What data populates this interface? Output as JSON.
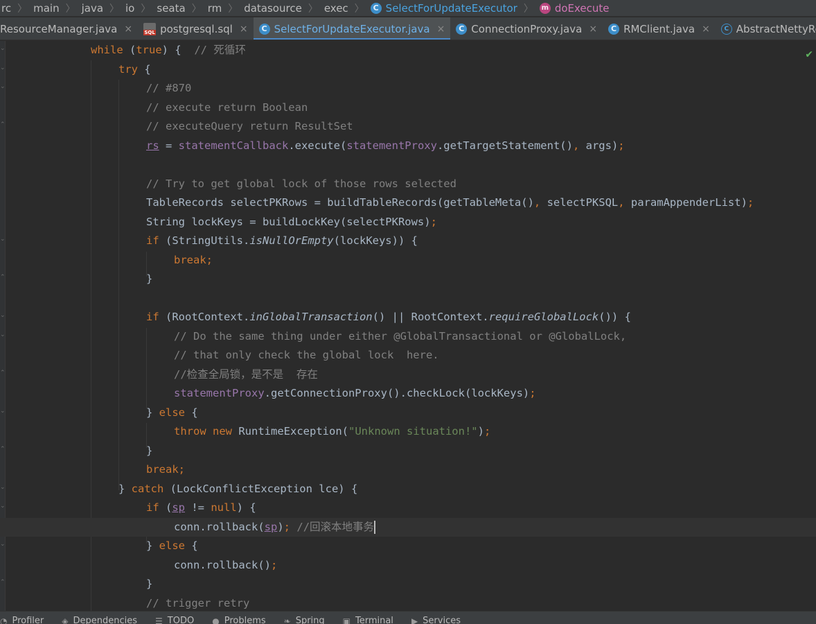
{
  "breadcrumb": {
    "items": [
      "rc",
      "main",
      "java",
      "io",
      "seata",
      "rm",
      "datasource",
      "exec"
    ],
    "class_name": "SelectForUpdateExecutor",
    "method_name": "doExecute",
    "class_icon": "class-icon",
    "method_icon": "method-icon"
  },
  "tabs": [
    {
      "label": "ResourceManager.java",
      "icon": "none"
    },
    {
      "label": "postgresql.sql",
      "icon": "sql-file-icon"
    },
    {
      "label": "SelectForUpdateExecutor.java",
      "icon": "class-icon",
      "active": true
    },
    {
      "label": "ConnectionProxy.java",
      "icon": "class-icon"
    },
    {
      "label": "RMClient.java",
      "icon": "class-icon"
    },
    {
      "label": "AbstractNettyRe",
      "icon": "abstract-class-icon"
    }
  ],
  "tab_close_glyph": "×",
  "code": {
    "lines": [
      "while (true) {  // 死循环",
      "try {",
      "// #870",
      "// execute return Boolean",
      "// executeQuery return ResultSet",
      "rs = statementCallback.execute(statementProxy.getTargetStatement(), args);",
      "",
      "// Try to get global lock of those rows selected",
      "TableRecords selectPKRows = buildTableRecords(getTableMeta(), selectPKSQL, paramAppenderList);",
      "String lockKeys = buildLockKey(selectPKRows);",
      "if (StringUtils.isNullOrEmpty(lockKeys)) {",
      "break;",
      "}",
      "",
      "if (RootContext.inGlobalTransaction() || RootContext.requireGlobalLock()) {",
      "// Do the same thing under either @GlobalTransactional or @GlobalLock,",
      "// that only check the global lock  here.",
      "//检查全局锁，是不是  存在",
      "statementProxy.getConnectionProxy().checkLock(lockKeys);",
      "} else {",
      "throw new RuntimeException(\"Unknown situation!\");",
      "}",
      "break;",
      "} catch (LockConflictException lce) {",
      "if (sp != null) {",
      "conn.rollback(sp); //回滚本地事务",
      "} else {",
      "conn.rollback();",
      "}",
      "// trigger retry"
    ]
  },
  "bottom_tools": [
    {
      "label": "Profiler",
      "icon": "profiler-icon"
    },
    {
      "label": "Dependencies",
      "icon": "dependencies-icon"
    },
    {
      "label": "TODO",
      "icon": "todo-icon"
    },
    {
      "label": "Problems",
      "icon": "problems-icon"
    },
    {
      "label": "Spring",
      "icon": "spring-icon"
    },
    {
      "label": "Terminal",
      "icon": "terminal-icon"
    },
    {
      "label": "Services",
      "icon": "services-icon"
    }
  ],
  "colors": {
    "keyword": "#cc7832",
    "comment": "#808080",
    "string": "#6a8759",
    "field": "#9876aa",
    "active_tab_text": "#6eb1e8"
  }
}
